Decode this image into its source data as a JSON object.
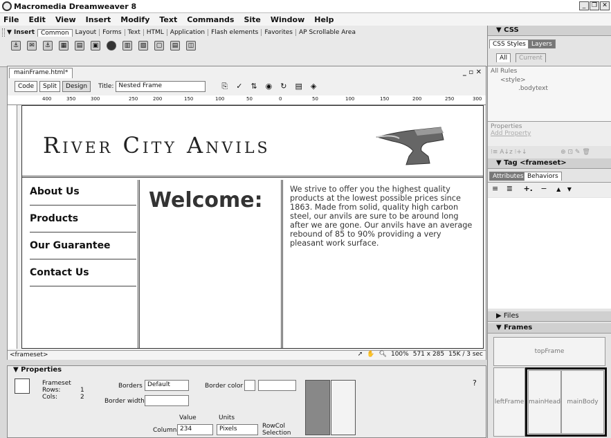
{
  "app": {
    "title": "Macromedia Dreamweaver 8"
  },
  "menu": [
    "File",
    "Edit",
    "View",
    "Insert",
    "Modify",
    "Text",
    "Commands",
    "Site",
    "Window",
    "Help"
  ],
  "insert_bar": {
    "label": "▼ Insert",
    "tabs": [
      "Common",
      "Layout",
      "Forms",
      "Text",
      "HTML",
      "Application",
      "Flash elements",
      "Favorites",
      "AP Scrollable Area"
    ]
  },
  "document": {
    "tab": "mainFrame.html*",
    "code_label": "Code",
    "split_label": "Split",
    "design_label": "Design",
    "title_label": "Title:",
    "title_value": "Nested Frame",
    "ruler_ticks": [
      "400",
      "350",
      "300",
      "250",
      "200",
      "150",
      "100",
      "50",
      "0",
      "50",
      "100",
      "150",
      "200",
      "250",
      "300"
    ]
  },
  "page": {
    "logo": "River City Anvils",
    "nav": [
      "About Us",
      "Products",
      "Our Guarantee",
      "Contact Us"
    ],
    "welcome": "Welcome:",
    "body": "We strive to offer you the highest quality products at the lowest possible prices since 1863. Made from solid, quality high carbon steel, our anvils are sure to be around long after we are gone. Our anvils have an average rebound of 85 to 90% providing a very pleasant work surface."
  },
  "statusbar": {
    "tag": "<frameset>",
    "zoom": "100%",
    "size": "571 x 285",
    "download": "15K / 3 sec"
  },
  "properties": {
    "header": "▼ Properties",
    "type": "Frameset",
    "rows_label": "Rows:",
    "rows": "1",
    "cols_label": "Cols:",
    "cols": "2",
    "borders_label": "Borders",
    "borders": "Default",
    "border_color_label": "Border color",
    "border_width_label": "Border width",
    "value_label": "Value",
    "units_label": "Units",
    "column_label": "Column",
    "column_value": "234",
    "units_value": "Pixels",
    "rowcol_label": "RowCol Selection"
  },
  "panels": {
    "css_header": "▼ CSS",
    "css_tabs": [
      "CSS Styles",
      "Layers"
    ],
    "css_subtabs": [
      "All",
      "Current"
    ],
    "all_rules": "All Rules",
    "rules": [
      "<style>",
      ".bodytext"
    ],
    "properties_label": "Properties",
    "add_property": "Add Property",
    "tag_header": "▼ Tag <frameset>",
    "tag_tabs": [
      "Attributes",
      "Behaviors"
    ],
    "files_header": "▶ Files",
    "frames_header": "▼ Frames",
    "frames": {
      "top": "topFrame",
      "left": "leftFrame",
      "header": "mainHeader",
      "body": "mainBody"
    }
  }
}
